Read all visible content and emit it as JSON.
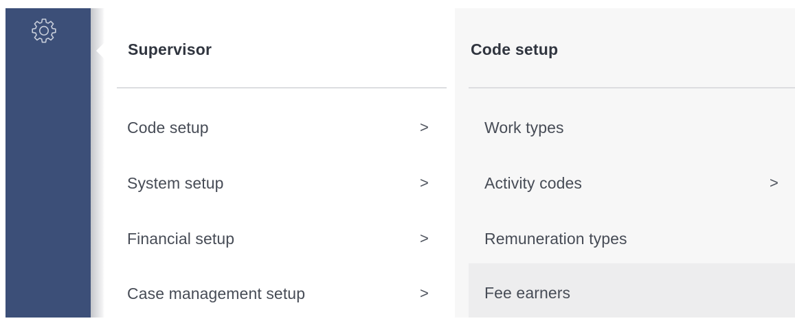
{
  "sidebar": {
    "icon": "gear-icon",
    "bg_color": "#3c4f78"
  },
  "supervisor_panel": {
    "title": "Supervisor",
    "items": [
      {
        "label": "Code setup",
        "chevron": ">"
      },
      {
        "label": "System setup",
        "chevron": ">"
      },
      {
        "label": "Financial setup",
        "chevron": ">"
      },
      {
        "label": "Case management setup",
        "chevron": ">"
      }
    ]
  },
  "code_setup_panel": {
    "title": "Code setup",
    "items": [
      {
        "label": "Work types"
      },
      {
        "label": "Activity codes",
        "chevron": ">"
      },
      {
        "label": "Remuneration types"
      },
      {
        "label": "Fee earners",
        "hovered": true
      }
    ]
  }
}
